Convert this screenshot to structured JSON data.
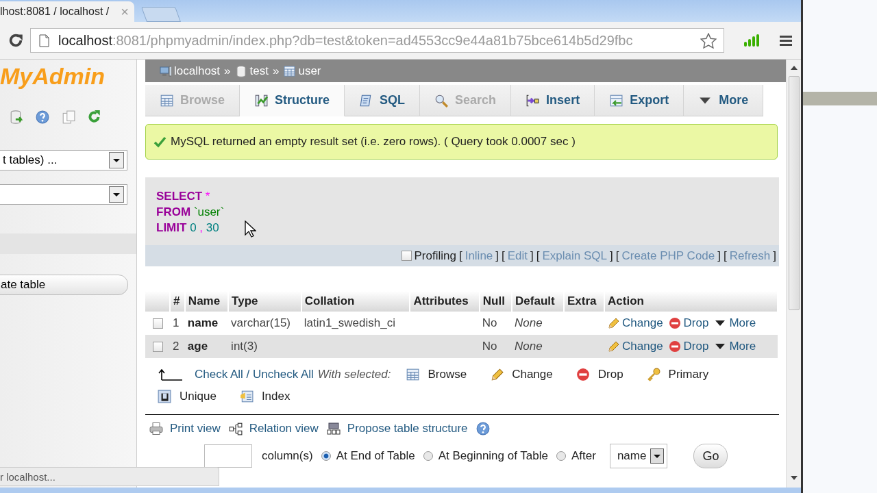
{
  "browser": {
    "tab_title": "lhost:8081 / localhost /",
    "tab_close": "×",
    "url_host": "localhost",
    "url_rest": ":8081/phpmyadmin/index.php?db=test&token=ad4553cc9e44a81b75bce614b5d29fbc"
  },
  "sidebar": {
    "logo": "MyAdmin",
    "selects": [
      {
        "kind": "filled",
        "value": "t tables) ..."
      },
      {
        "kind": "blank"
      }
    ],
    "create_button": "ate table",
    "status": "r localhost..."
  },
  "breadcrumb": [
    {
      "label": "localhost",
      "kind": "server"
    },
    {
      "label": "test",
      "kind": "database"
    },
    {
      "label": "user",
      "kind": "table"
    }
  ],
  "separator": "»",
  "tabs": [
    {
      "label": "Browse",
      "kind": "browse",
      "selected": false,
      "disabled": true
    },
    {
      "label": "Structure",
      "kind": "structure",
      "selected": true,
      "disabled": false
    },
    {
      "label": "SQL",
      "kind": "sql",
      "selected": false,
      "disabled": false
    },
    {
      "label": "Search",
      "kind": "search",
      "selected": false,
      "disabled": true
    },
    {
      "label": "Insert",
      "kind": "insert",
      "selected": false,
      "disabled": false
    },
    {
      "label": "Export",
      "kind": "export",
      "selected": false,
      "disabled": false
    },
    {
      "label": "More",
      "kind": "more",
      "selected": false,
      "disabled": false
    }
  ],
  "message": "MySQL returned an empty result set (i.e. zero rows). ( Query took 0.0007 sec )",
  "query": [
    [
      {
        "text": "SELECT",
        "kind": "keyword"
      },
      {
        "text": "*",
        "kind": "operator"
      }
    ],
    [
      {
        "text": "FROM",
        "kind": "keyword"
      },
      {
        "text": "`user`",
        "kind": "identifier"
      }
    ],
    [
      {
        "text": "LIMIT",
        "kind": "keyword"
      },
      {
        "text": "0",
        "kind": "number"
      },
      {
        "text": ",",
        "kind": "operator"
      },
      {
        "text": "30",
        "kind": "number"
      }
    ]
  ],
  "query_options": {
    "profiling": {
      "label": "Profiling",
      "checked": false
    },
    "brackets": [
      "[",
      "]"
    ],
    "links": [
      "Inline",
      "Edit",
      "Explain SQL",
      "Create PHP Code",
      "Refresh"
    ]
  },
  "table": {
    "columns": [
      "#",
      "Name",
      "Type",
      "Collation",
      "Attributes",
      "Null",
      "Default",
      "Extra",
      "Action"
    ],
    "rows": [
      {
        "checked": false,
        "highlighted": false,
        "number": "1",
        "name": "name",
        "type": "varchar(15)",
        "collation": "latin1_swedish_ci",
        "null": "No",
        "default": "None",
        "actions": [
          {
            "label": "Change",
            "kind": "change"
          },
          {
            "label": "Drop",
            "kind": "drop"
          },
          {
            "label": "More",
            "kind": "more"
          }
        ]
      },
      {
        "checked": false,
        "highlighted": true,
        "number": "2",
        "name": "age",
        "type": "int(3)",
        "null": "No",
        "default": "None",
        "actions": [
          {
            "label": "Change",
            "kind": "change"
          },
          {
            "label": "Drop",
            "kind": "drop"
          },
          {
            "label": "More",
            "kind": "more"
          }
        ]
      }
    ]
  },
  "bulk": {
    "check_all": "Check All / Uncheck All",
    "with_selected": "With selected:",
    "actions": [
      {
        "label": "Browse",
        "kind": "browse"
      },
      {
        "label": "Change",
        "kind": "change"
      },
      {
        "label": "Drop",
        "kind": "drop"
      },
      {
        "label": "Primary",
        "kind": "primary"
      },
      {
        "label": "Unique",
        "kind": "unique"
      },
      {
        "label": "Index",
        "kind": "index"
      }
    ]
  },
  "links": [
    {
      "label": "Print view",
      "kind": "print"
    },
    {
      "label": "Relation view",
      "kind": "relation"
    },
    {
      "label": "Propose table structure",
      "kind": "propose"
    }
  ],
  "add_column": {
    "unit": "column(s)",
    "positions": [
      {
        "label": "At End of Table",
        "selected": true
      },
      {
        "label": "At Beginning of Table",
        "selected": false
      },
      {
        "label": "After",
        "selected": false
      }
    ],
    "after_field": "name",
    "button": "Go"
  }
}
